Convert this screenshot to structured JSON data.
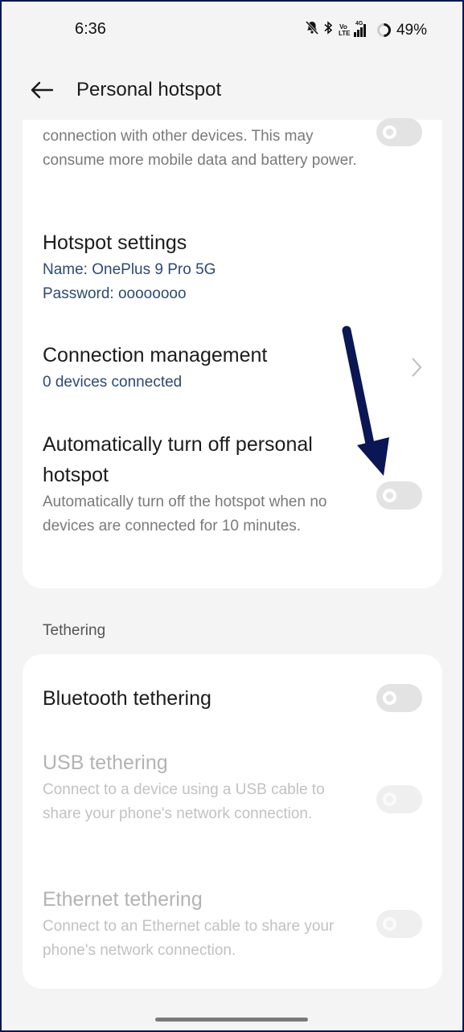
{
  "status_bar": {
    "time": "6:36",
    "icons": [
      "bell-muted-icon",
      "bluetooth-icon",
      "volte-icon",
      "signal-4g-icon",
      "battery-ring-icon"
    ],
    "volte_label": "Vo LTE",
    "network_label": "4G",
    "battery_percent": "49%"
  },
  "header": {
    "title": "Personal hotspot",
    "back_icon": "arrow-left-icon"
  },
  "hotspot_card": {
    "partial_item": {
      "desc": "connection with other devices. This may consume more mobile data and battery power.",
      "toggle_on": false
    },
    "hotspot_settings": {
      "title": "Hotspot settings",
      "name_line": "Name: OnePlus 9 Pro 5G",
      "password_line": "Password: oooooooo"
    },
    "connection_management": {
      "title": "Connection management",
      "subtitle": "0 devices connected"
    },
    "auto_turn_off": {
      "title": "Automatically turn off personal hotspot",
      "desc": "Automatically turn off the hotspot when no devices are connected for 10 minutes.",
      "toggle_on": false
    }
  },
  "annotation": {
    "arrow_color": "#0b1655",
    "points_to": "auto-turn-off-toggle"
  },
  "tethering": {
    "section_label": "Tethering",
    "items": [
      {
        "title": "Bluetooth tethering",
        "desc": "",
        "enabled": true,
        "toggle_on": false
      },
      {
        "title": "USB tethering",
        "desc": "Connect to a device using a USB cable to share your phone's network connection.",
        "enabled": false,
        "toggle_on": false
      },
      {
        "title": "Ethernet tethering",
        "desc": "Connect to an Ethernet cable to share your phone's network connection.",
        "enabled": false,
        "toggle_on": false
      }
    ]
  },
  "colors": {
    "background": "#f4f4f4",
    "card": "#ffffff",
    "link_text": "#2b4a72",
    "toggle_off": "#e3e3e3",
    "frame": "#0b1655"
  }
}
